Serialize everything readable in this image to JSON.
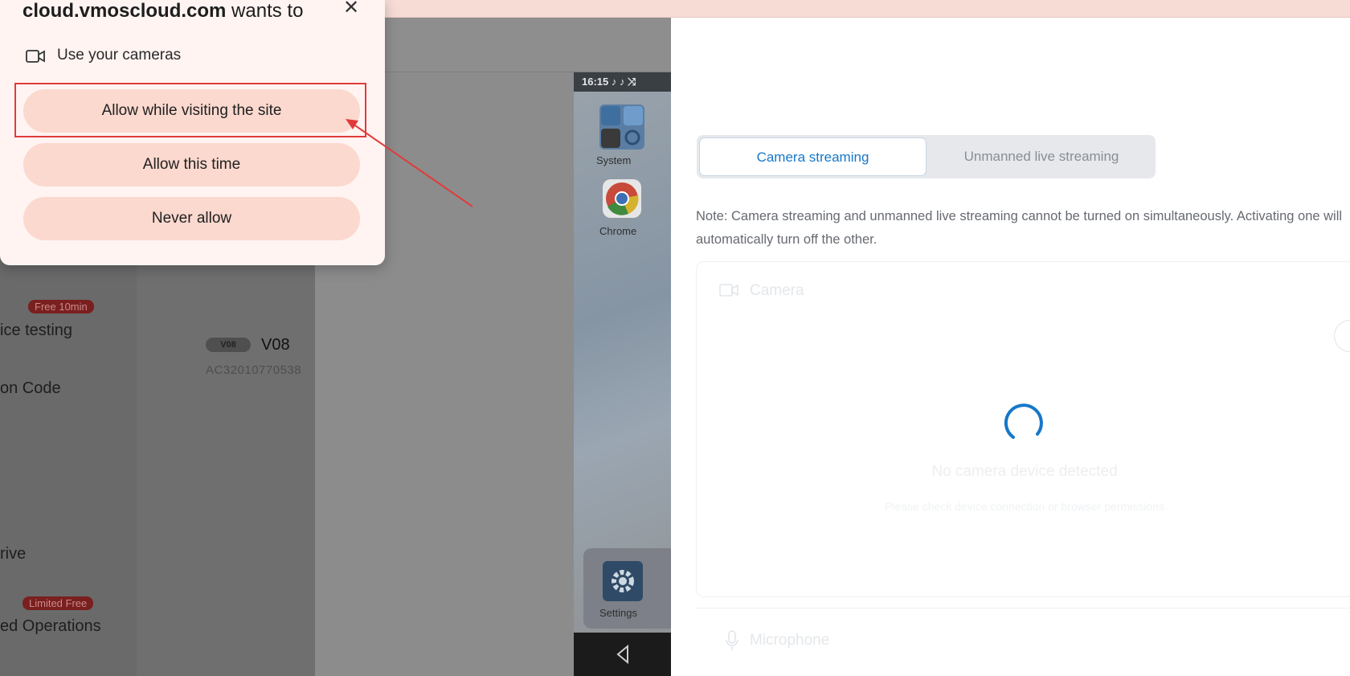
{
  "popup": {
    "origin": "cloud.vmoscloud.com",
    "suffix": " wants to",
    "permission_label": "Use your cameras",
    "buttons": [
      "Allow while visiting the site",
      "Allow this time",
      "Never allow"
    ]
  },
  "left_app": {
    "badge_free": "Free 10min",
    "item_testing": "ice testing",
    "item_code": "on Code",
    "item_drive": "rive",
    "badge_limited": "Limited Free",
    "item_operations": "ed Operations",
    "device_chip": "V08",
    "device_name": "V08",
    "device_id": "AC32010770538"
  },
  "phone": {
    "time": "16:15",
    "apps": [
      "System",
      "Chrome",
      "Settings"
    ]
  },
  "streaming": {
    "tabs": [
      "Camera streaming",
      "Unmanned live streaming"
    ],
    "active_tab": 0,
    "note": "Note: Camera streaming and unmanned live streaming cannot be turned on simultaneously. Activating one will automatically turn off the other.",
    "camera_title": "Camera",
    "empty_title": "No camera device detected",
    "empty_sub": "Please check device connection or browser permissions",
    "mic_title": "Microphone"
  },
  "colors": {
    "accent": "#1677c9",
    "popup_button": "#fbd9cf",
    "highlight": "#e23a3a"
  }
}
